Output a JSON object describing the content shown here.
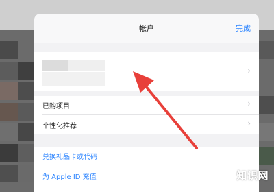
{
  "nav": {
    "title": "帐户",
    "done_label": "完成"
  },
  "account": {
    "chevron": "›"
  },
  "menu": {
    "purchased": "已购项目",
    "personalized": "个性化推荐",
    "redeem": "兑换礼品卡或代码",
    "add_funds": "为 Apple ID 充值"
  },
  "chevrons": {
    "glyph": "›"
  },
  "watermark": "知识网",
  "colors": {
    "accent": "#2f86ff",
    "annotation_arrow": "#e8403a"
  }
}
